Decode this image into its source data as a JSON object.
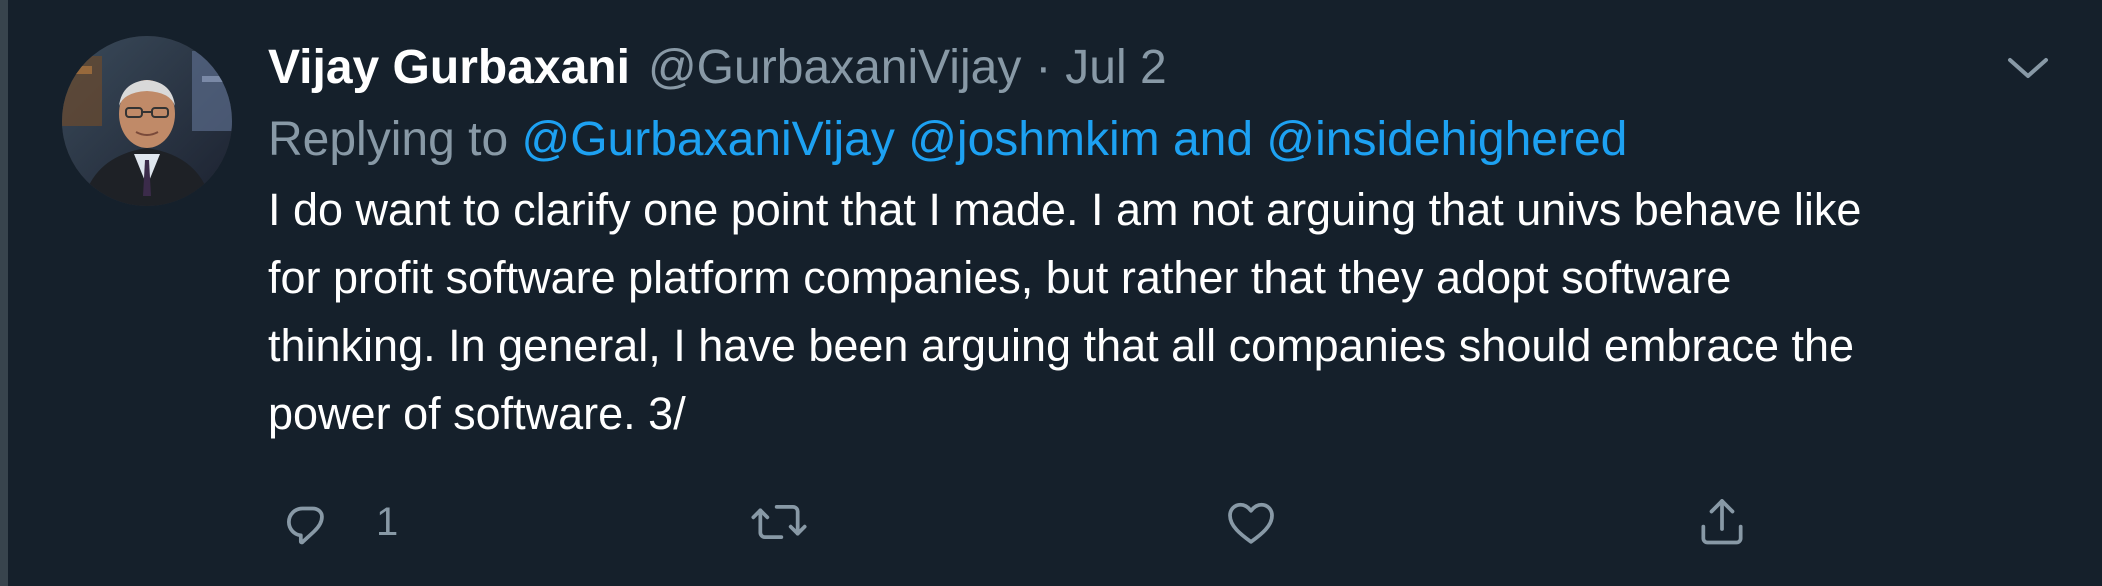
{
  "tweet": {
    "display_name": "Vijay Gurbaxani",
    "handle": "@GurbaxaniVijay",
    "separator": "·",
    "date": "Jul 2",
    "replying_prefix": "Replying to",
    "mentions": [
      "@GurbaxaniVijay",
      "@joshmkim"
    ],
    "mention_joiner": "and",
    "last_mention": "@insidehighered",
    "text_lines": [
      "I do want to clarify one point that I made. I am not arguing that univs behave like",
      "for profit software platform companies, but rather that they adopt software",
      "thinking. In general, I have been arguing that all companies should embrace the",
      "power of software. 3/"
    ],
    "reply_count": "1",
    "retweet_count": "",
    "like_count": ""
  },
  "icons": {
    "reply": "reply-icon",
    "retweet": "retweet-icon",
    "like": "heart-icon",
    "share": "share-icon",
    "caret": "chevron-down-icon"
  },
  "colors": {
    "background": "#15202b",
    "text": "#ffffff",
    "secondary": "#8899a6",
    "link": "#1da1f2"
  }
}
